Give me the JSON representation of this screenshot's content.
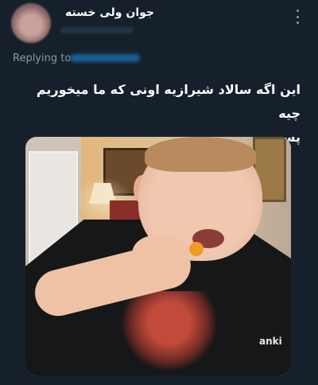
{
  "tweet": {
    "author_name": "جوان ولی خسته",
    "replying_prefix": "Replying to",
    "text_line1": "این اگه سالاد شیرازیه اونی که ما میخوریم چیه",
    "text_line2": "پس"
  },
  "photo": {
    "shirt_brand": "anki"
  },
  "icons": {
    "more": "vertical-ellipsis-icon"
  },
  "colors": {
    "background": "#15202b",
    "secondary_text": "#8899a6",
    "link": "#1d9bf0"
  }
}
